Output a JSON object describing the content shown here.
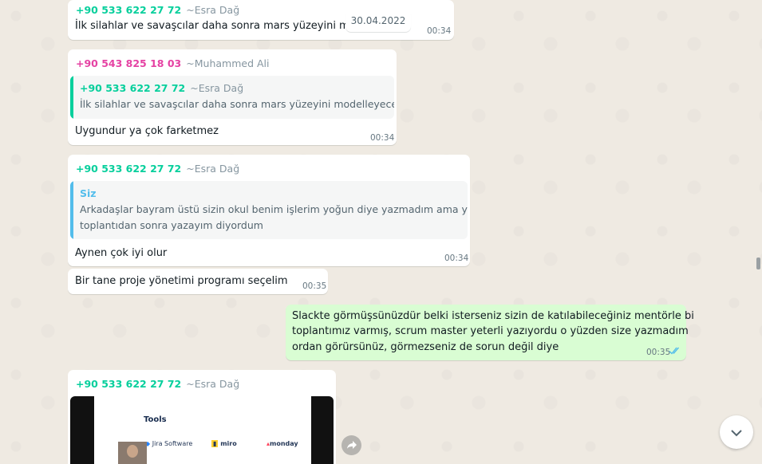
{
  "date_pill": "30.04.2022",
  "messages": [
    {
      "phone": "+90 533 622 27 72",
      "name": "~Esra Dağ",
      "text": "İlk silahlar ve savaşcılar daha sonra mars yüzeyini mod",
      "time": "00:34"
    },
    {
      "phone": "+90 543 825 18 03",
      "name": "~Muhammed Ali",
      "quote": {
        "phone": "+90 533 622 27 72",
        "name": "~Esra Dağ",
        "text": "İlk silahlar ve savaşcılar daha sonra mars yüzeyini modelleyeceğim"
      },
      "text": "Uygundur ya çok farketmez",
      "time": "00:34"
    },
    {
      "phone": "+90 533 622 27 72",
      "name": "~Esra Dağ",
      "quote": {
        "name": "Siz",
        "line1": "Arkadaşlar bayram üstü sizin okul benim işlerim yoğun diye yazmadım ama yarın",
        "line2": "toplantıdan sonra yazayım diyordum"
      },
      "text": "Aynen çok iyi olur",
      "time": "00:34"
    },
    {
      "text": "Bir tane proje yönetimi programı seçelim",
      "time": "00:35"
    },
    {
      "lines": [
        "Slackte görmüşsünüzdür belki isterseniz sizin de katılabileceğiniz mentörle bi",
        "toplantımız varmış, scrum master yeterli yazıyordu o yüzden size yazmadım",
        "ordan görürsünüz, görmezseniz de sorun değil diye"
      ],
      "time": "00:35",
      "status": "double-check-read"
    },
    {
      "phone": "+90 533 622 27 72",
      "name": "~Esra Dağ",
      "media": {
        "title": "Tools",
        "logos": [
          "Jira Software",
          "miro",
          "monday"
        ]
      }
    }
  ],
  "colors": {
    "background": "#efeae2",
    "incoming": "#ffffff",
    "outgoing": "#d9fdd3",
    "sender_green": "#06cf9c",
    "sender_pink": "#e542a3",
    "quote_bar_green": "#06cf9c",
    "quote_bar_blue": "#53bdeb",
    "read_tick": "#53bdeb"
  }
}
